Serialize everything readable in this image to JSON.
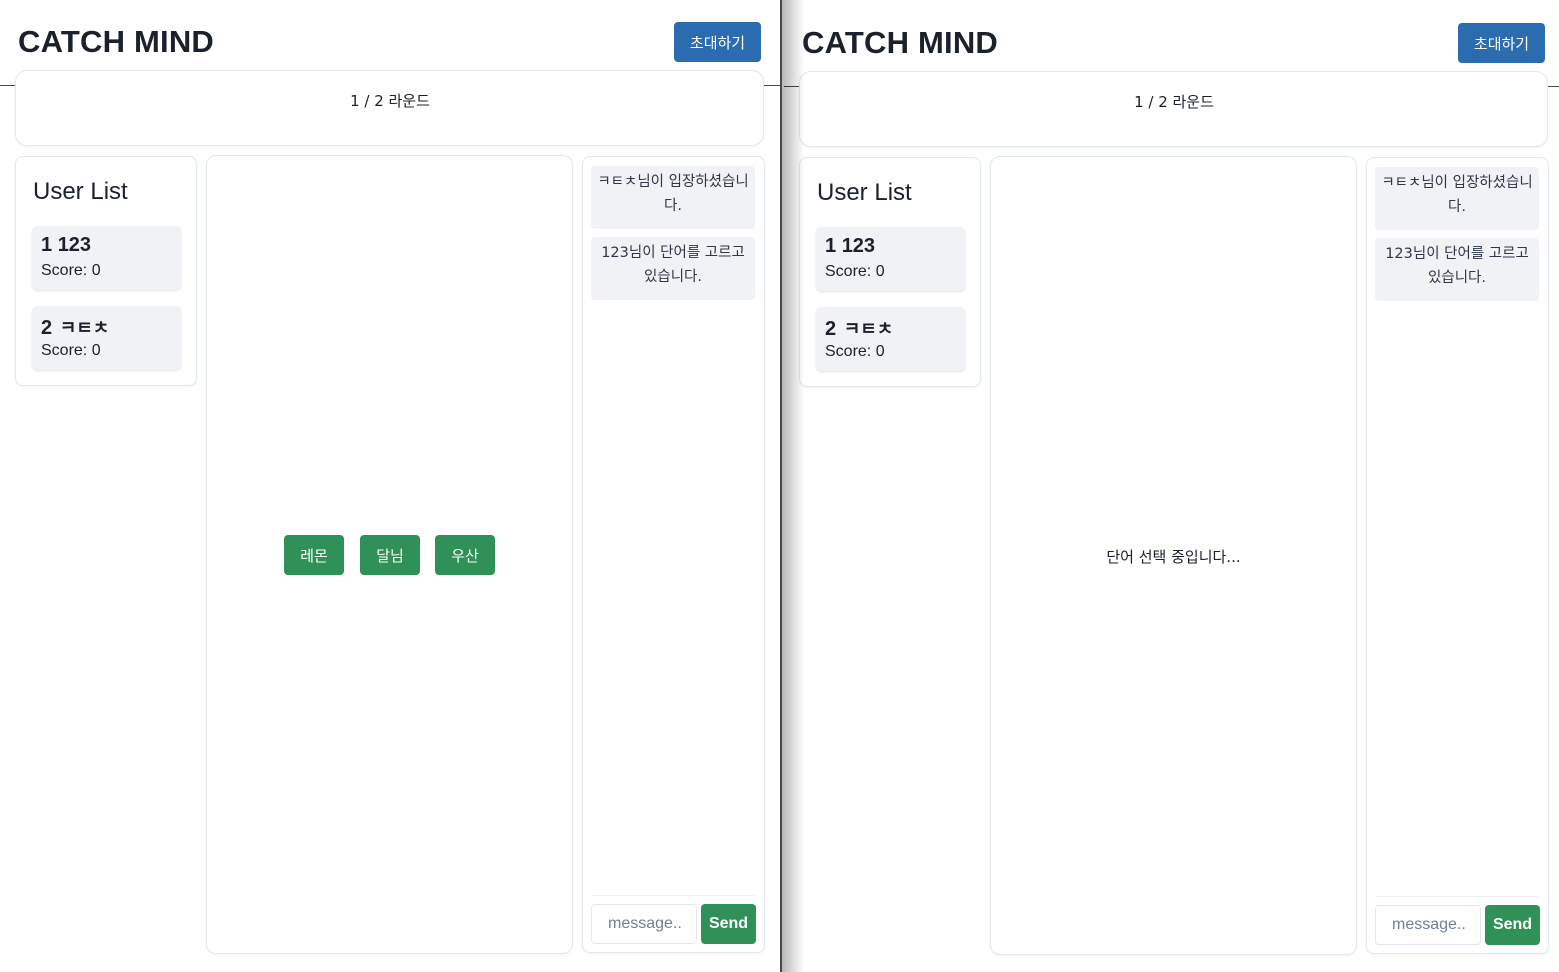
{
  "app": {
    "title": "CATCH MIND",
    "invite_label": "초대하기"
  },
  "round": {
    "text": "1 / 2 라운드"
  },
  "user_list": {
    "title": "User List",
    "users": [
      {
        "rank": "1",
        "name": "123",
        "score_text": "Score: 0"
      },
      {
        "rank": "2",
        "name": "ㅋㅌㅊ",
        "score_text": "Score: 0"
      }
    ]
  },
  "left_canvas": {
    "word_choices": [
      "레몬",
      "달님",
      "우산"
    ]
  },
  "right_canvas": {
    "status_text": "단어 선택 중입니다..."
  },
  "chat": {
    "messages": [
      "ㅋㅌㅊ님이 입장하셨습니다.",
      "123님이 단어를 고르고 있습니다."
    ],
    "input_placeholder": "message..",
    "send_label": "Send"
  },
  "colors": {
    "primary_blue": "#2b6cb0",
    "green": "#2f9158",
    "card_bg": "#f1f2f5"
  }
}
